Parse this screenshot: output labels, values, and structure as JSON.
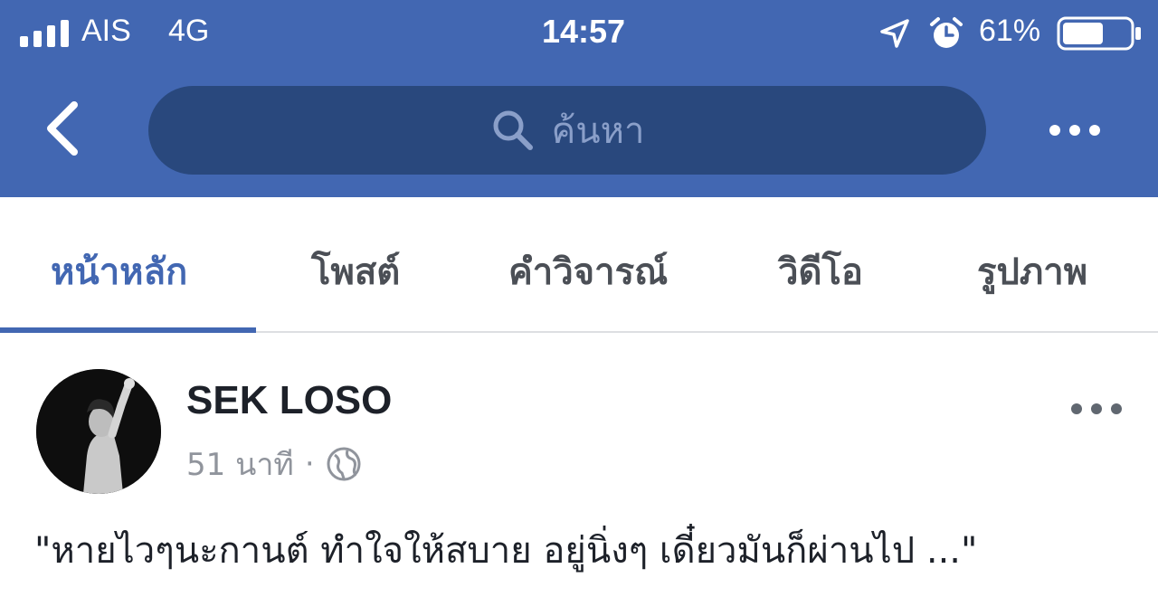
{
  "status_bar": {
    "carrier": "AIS",
    "network": "4G",
    "time": "14:57",
    "battery_percent": "61%",
    "signal_icon": "signal-bars-icon",
    "location_icon": "location-arrow-icon",
    "alarm_icon": "alarm-clock-icon",
    "battery_icon": "battery-icon",
    "battery_level": 0.61
  },
  "nav": {
    "back_icon": "chevron-left-icon",
    "search_icon": "search-icon",
    "search_placeholder": "ค้นหา",
    "more_icon": "more-horizontal-icon"
  },
  "tabs": [
    {
      "label": "หน้าหลัก",
      "active": true
    },
    {
      "label": "โพสต์",
      "active": false
    },
    {
      "label": "คำวิจารณ์",
      "active": false
    },
    {
      "label": "วิดีโอ",
      "active": false
    },
    {
      "label": "รูปภาพ",
      "active": false
    }
  ],
  "post": {
    "author": "SEK LOSO",
    "time": "51 นาที",
    "separator": "·",
    "privacy_icon": "globe-icon",
    "more_icon": "more-horizontal-icon",
    "text": "\"หายไวๆนะกานต์ ทำใจให้สบาย อยู่นิ่งๆ เดี๋ยวมันก็ผ่านไป ...\""
  },
  "colors": {
    "brand_blue": "#4267b2",
    "search_bg": "#29487d",
    "text_dark": "#1d2129",
    "text_muted": "#90949c"
  }
}
